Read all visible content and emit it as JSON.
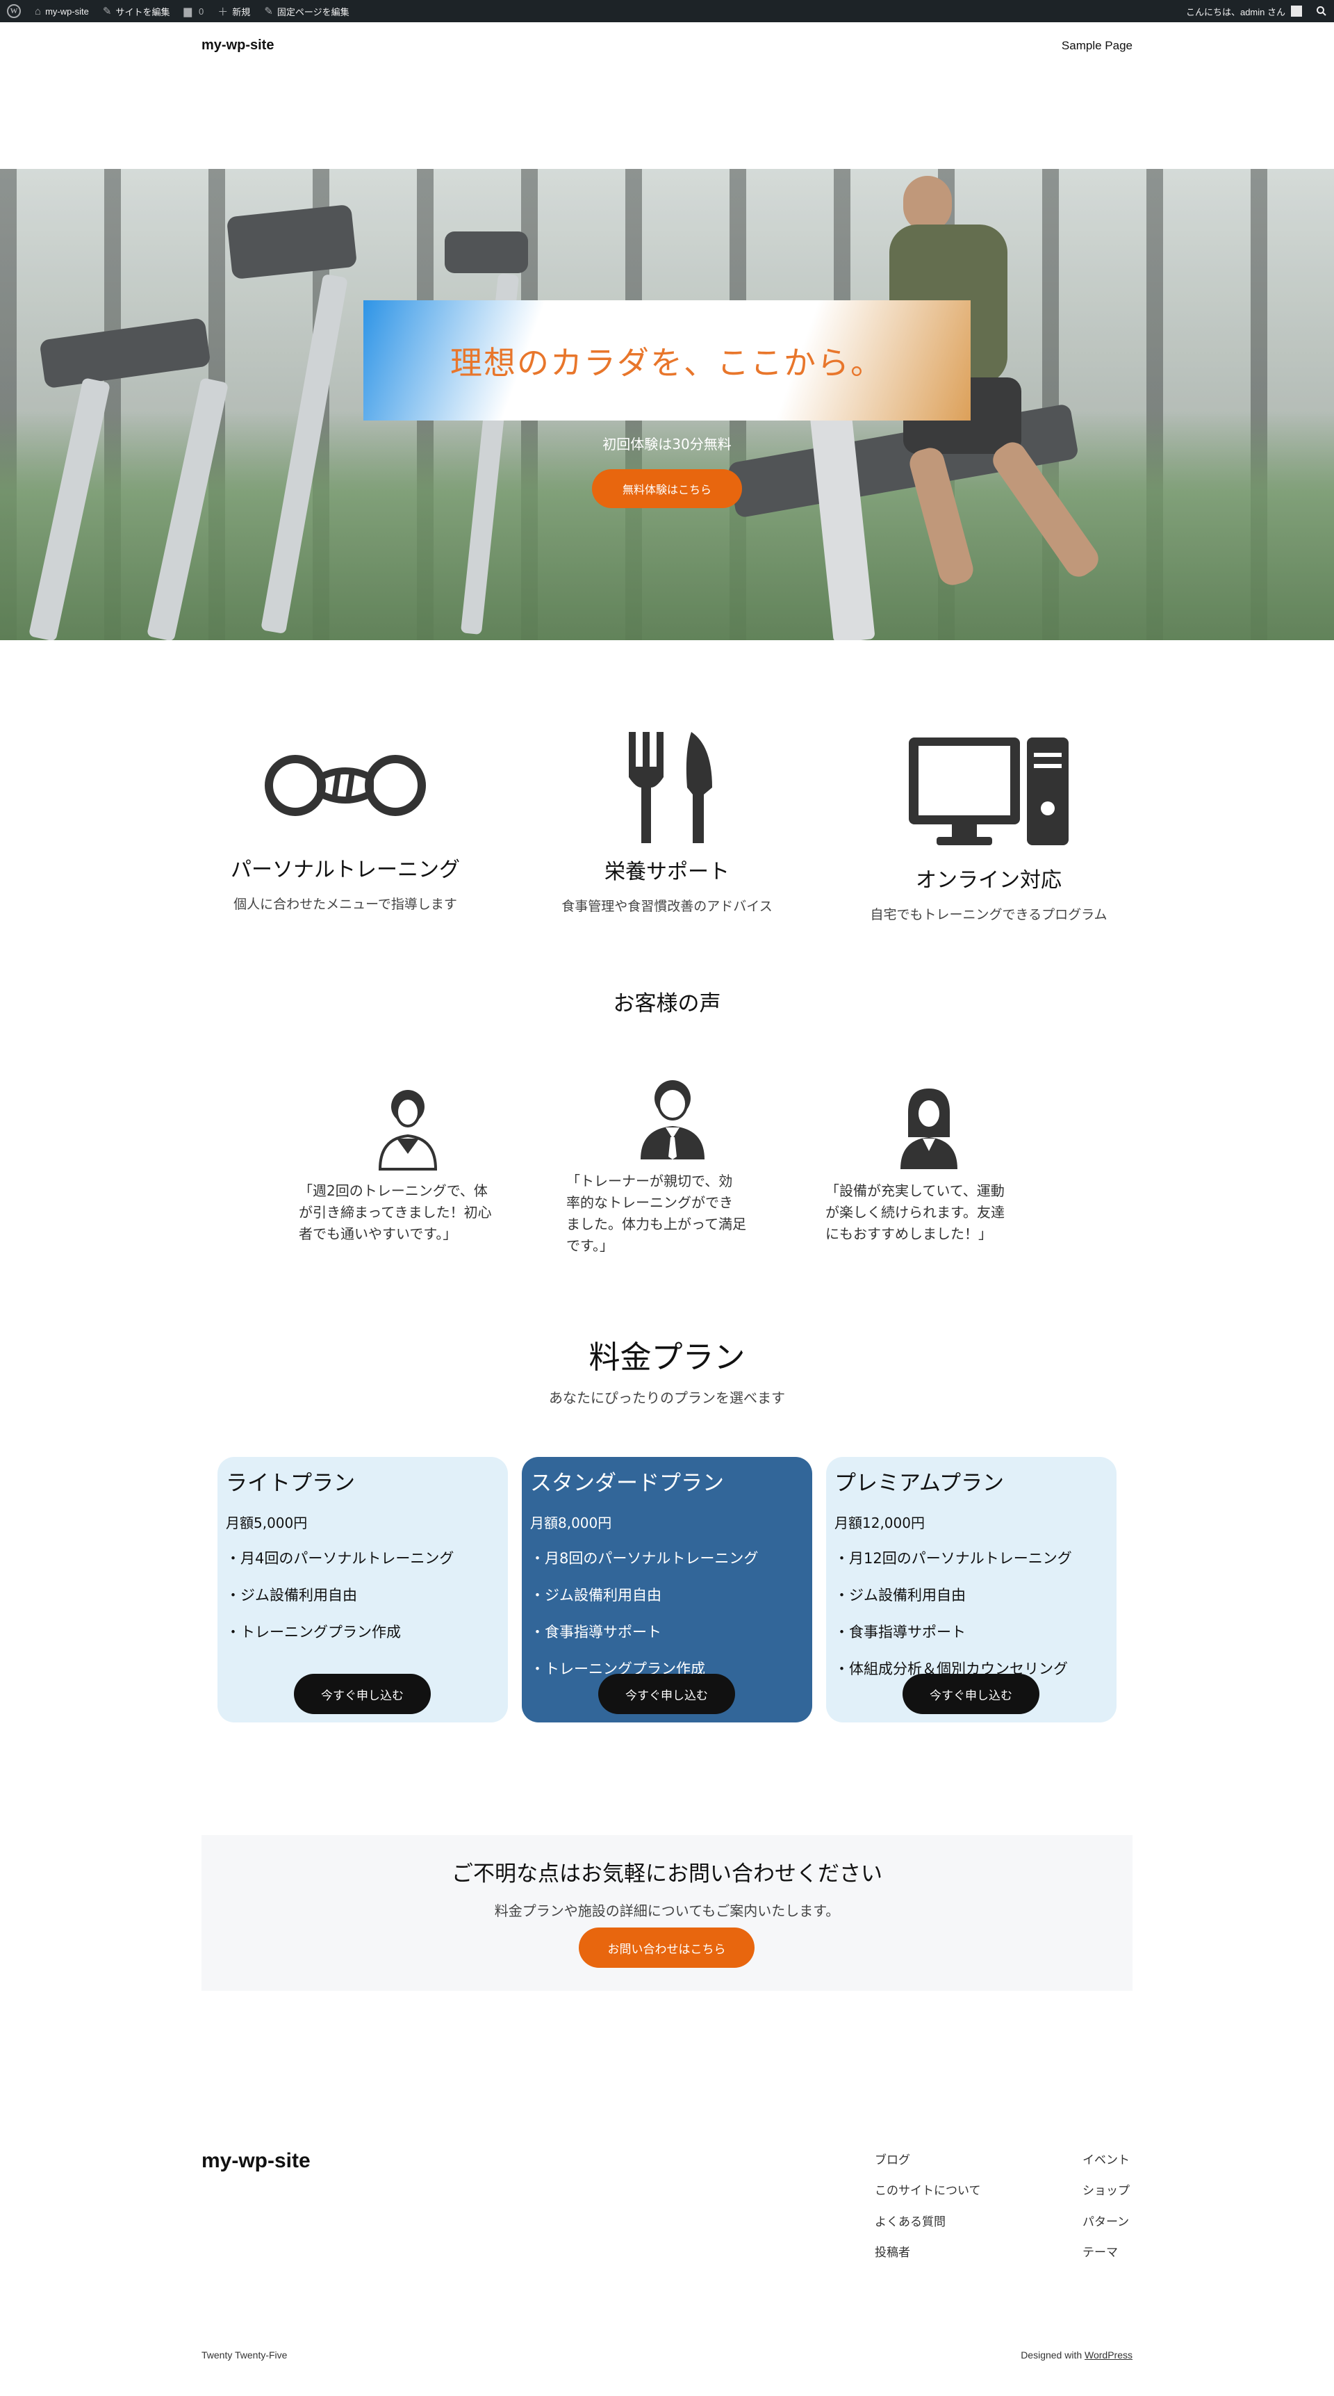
{
  "admin_bar": {
    "site_name": "my-wp-site",
    "edit_site": "サイトを編集",
    "comments_count": "0",
    "new": "新規",
    "edit_page": "固定ページを編集",
    "greeting": "こんにちは、admin さん"
  },
  "header": {
    "site_title": "my-wp-site",
    "nav_link": "Sample Page"
  },
  "hero": {
    "headline": "理想のカラダを、ここから。",
    "subtext": "初回体験は30分無料",
    "cta": "無料体験はこちら"
  },
  "features": [
    {
      "icon": "dumbbell-icon",
      "title": "パーソナルトレーニング",
      "desc": "個人に合わせたメニューで指導します"
    },
    {
      "icon": "fork-knife-icon",
      "title": "栄養サポート",
      "desc": "食事管理や食習慣改善のアドバイス"
    },
    {
      "icon": "desktop-computer-icon",
      "title": "オンライン対応",
      "desc": "自宅でもトレーニングできるプログラム"
    }
  ],
  "testimonials": {
    "title": "お客様の声",
    "items": [
      {
        "icon": "woman-avatar-icon",
        "lines": [
          "「週2回のトレーニングで、体",
          "が引き締まってきました！初心",
          "者でも通いやすいです。」"
        ]
      },
      {
        "icon": "man-avatar-icon",
        "lines": [
          "「トレーナーが親切で、効",
          "率的なトレーニングができ",
          "ました。体力も上がって満足",
          "です。」"
        ]
      },
      {
        "icon": "woman-suit-avatar-icon",
        "lines": [
          "「設備が充実していて、運動",
          "が楽しく続けられます。友達",
          "にもおすすめしました！」"
        ]
      }
    ]
  },
  "pricing": {
    "title": "料金プラン",
    "subtitle": "あなたにぴったりのプランを選べます",
    "plans": [
      {
        "name": "ライトプラン",
        "price": "月額5,000円",
        "features": [
          "・月4回のパーソナルトレーニング",
          "・ジム設備利用自由",
          "・トレーニングプラン作成"
        ],
        "cta": "今すぐ申し込む"
      },
      {
        "name": "スタンダードプラン",
        "price": "月額8,000円",
        "features": [
          "・月8回のパーソナルトレーニング",
          "・ジム設備利用自由",
          "・食事指導サポート",
          "・トレーニングプラン作成"
        ],
        "cta": "今すぐ申し込む"
      },
      {
        "name": "プレミアムプラン",
        "price": "月額12,000円",
        "features": [
          "・月12回のパーソナルトレーニング",
          "・ジム設備利用自由",
          "・食事指導サポート",
          "・体組成分析＆個別カウンセリング"
        ],
        "cta": "今すぐ申し込む"
      }
    ]
  },
  "contact": {
    "title": "ご不明な点はお気軽にお問い合わせください",
    "desc": "料金プランや施設の詳細についてもご案内いたします。",
    "cta": "お問い合わせはこちら"
  },
  "footer": {
    "site_title": "my-wp-site",
    "col1": [
      "ブログ",
      "このサイトについて",
      "よくある質問",
      "投稿者"
    ],
    "col2": [
      "イベント",
      "ショップ",
      "パターン",
      "テーマ"
    ],
    "theme_credit": "Twenty Twenty-Five",
    "designed_with": "Designed with ",
    "wordpress_link": "WordPress"
  },
  "colors": {
    "accent_orange": "#e8660e",
    "standard_plan_blue": "#326699",
    "light_plan_bg": "#e1f0f9",
    "admin_bar_bg": "#1d2327"
  }
}
